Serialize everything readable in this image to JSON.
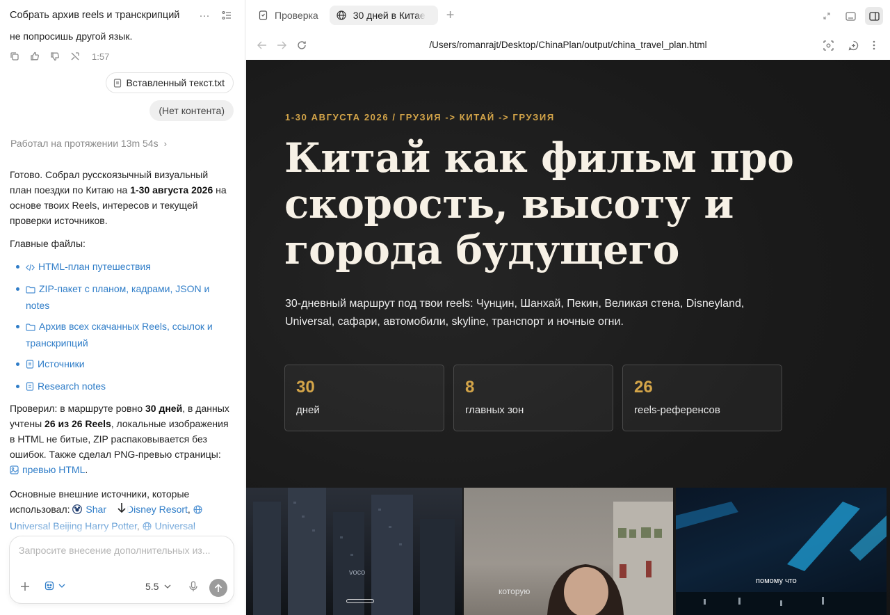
{
  "chat": {
    "title": "Собрать архив reels и транскрипций",
    "prev_line": "не попросишь другой язык.",
    "msg_time": "1:57",
    "attachment": "Вставленный текст.txt",
    "empty_content": "(Нет контента)",
    "worked": "Работал на протяжении 13m 54s",
    "answer": {
      "intro_1": "Готово. Собрал русскоязычный визуальный план поездки по Китаю на ",
      "intro_bold": "1-30 августа 2026",
      "intro_2": " на основе твоих Reels, интересов и текущей проверки источников.",
      "files_heading": "Главные файлы:",
      "files": [
        {
          "icon": "code-icon",
          "label": "HTML-план путешествия"
        },
        {
          "icon": "folder-icon",
          "label": "ZIP-пакет с планом, кадрами, JSON и notes"
        },
        {
          "icon": "folder-icon",
          "label": "Архив всех скачанных Reels, ссылок и транскрипций"
        },
        {
          "icon": "doc-icon",
          "label": "Источники"
        },
        {
          "icon": "doc-icon",
          "label": "Research notes"
        }
      ],
      "check_1": "Проверил: в маршруте ровно ",
      "check_b1": "30 дней",
      "check_2": ", в данных учтены ",
      "check_b2": "26 из 26 Reels",
      "check_3": ", локальные изображения в HTML не битые, ZIP распаковывается без ошибок. Также сделал PNG-превью страницы: ",
      "preview_link": "превью HTML",
      "check_4": ".",
      "sources_intro": "Основные внешние источники, которые использовал: ",
      "src_1": "Shar",
      "src_1b": "i Disney Resort",
      "src_2": "Universal Beijing Harry Potter",
      "src_3": "Universal"
    },
    "composer": {
      "placeholder": "Запросите внесение дополнительных из...",
      "model": "5.5"
    }
  },
  "browser": {
    "tabs": [
      {
        "label": "Проверка",
        "icon": "check-doc-icon"
      },
      {
        "label": "30 дней в Китае",
        "icon": "globe-icon"
      }
    ],
    "url": "/Users/romanrajt/Desktop/ChinaPlan/output/china_travel_plan.html"
  },
  "page": {
    "kicker": "1-30 АВГУСТА 2026 / ГРУЗИЯ -> КИТАЙ -> ГРУЗИЯ",
    "title": "Китай как фильм про скорость, высоту и города будущего",
    "subtitle": "30-дневный маршрут под твои reels: Чунцин, Шанхай, Пекин, Великая стена, Disneyland, Universal, сафари, автомобили, skyline, транспорт и ночные огни.",
    "stats": [
      {
        "num": "30",
        "label": "дней"
      },
      {
        "num": "8",
        "label": "главных зон"
      },
      {
        "num": "26",
        "label": "reels-референсов"
      }
    ],
    "reel_captions": [
      "которую",
      "помому что"
    ],
    "accent_color": "#d4a549"
  }
}
